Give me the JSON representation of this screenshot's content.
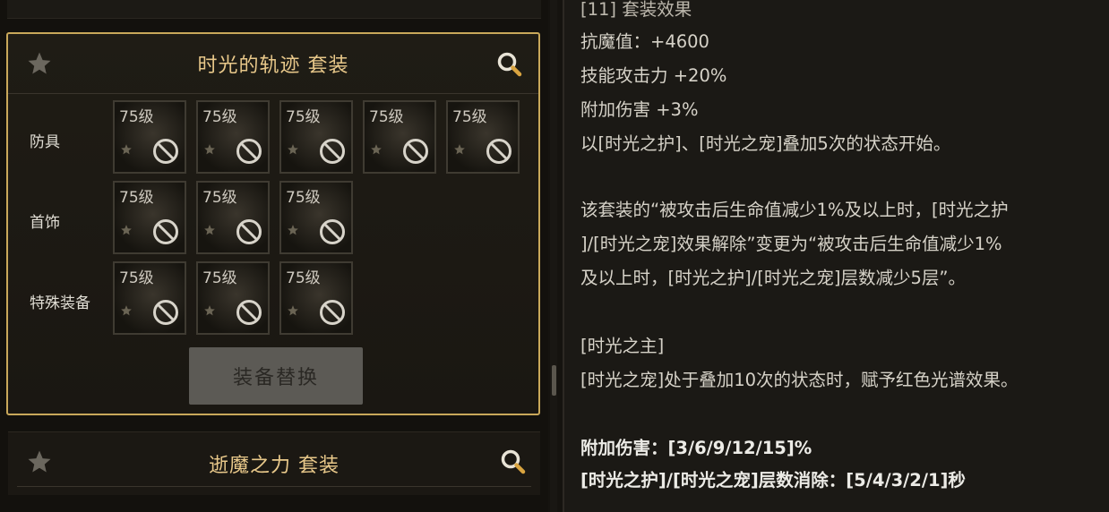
{
  "set_panel": {
    "title": "时光的轨迹 套装",
    "rows": [
      {
        "label": "防具",
        "slots": [
          "75级",
          "75级",
          "75级",
          "75级",
          "75级"
        ]
      },
      {
        "label": "首饰",
        "slots": [
          "75级",
          "75级",
          "75级"
        ]
      },
      {
        "label": "特殊装备",
        "slots": [
          "75级",
          "75级",
          "75级"
        ]
      }
    ],
    "replace_button": "装备替换"
  },
  "set_panel_2": {
    "title": "逝魔之力 套装"
  },
  "description": {
    "lines": [
      "[11] 套装效果",
      "抗魔值：+4600",
      "技能攻击力 +20%",
      "附加伤害 +3%",
      "以[时光之护]、[时光之宠]叠加5次的状态开始。",
      "该套装的“被攻击后生命值减少1%及以上时，[时光之护",
      "]/[时光之宠]效果解除”变更为“被攻击后生命值减少1%",
      "及以上时，[时光之护]/[时光之宠]层数减少5层”。",
      "[时光之主]",
      "[时光之宠]处于叠加10次的状态时，赋予红色光谱效果。",
      "附加伤害：[3/6/9/12/15]%",
      "[时光之护]/[时光之宠]层数消除：[5/4/3/2/1]秒"
    ]
  },
  "icons": {
    "favorite": "star-icon",
    "inspect": "search-icon",
    "unavailable": "ban-icon"
  },
  "colors": {
    "accent_border": "#c9a85a",
    "title_gold": "#e8c88a",
    "text": "#d6d2c8"
  }
}
